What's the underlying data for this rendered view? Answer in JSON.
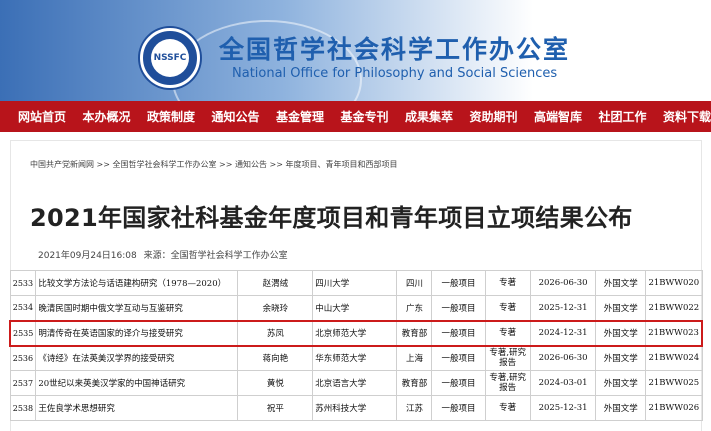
{
  "header": {
    "logo_text": "NSSFC",
    "title_cn": "全国哲学社会科学工作办公室",
    "title_en": "National Office for Philosophy and Social Sciences"
  },
  "nav": [
    "网站首页",
    "本办概况",
    "政策制度",
    "通知公告",
    "基金管理",
    "基金专刊",
    "成果集萃",
    "资助期刊",
    "高端智库",
    "社团工作",
    "资料下载"
  ],
  "breadcrumb": "中国共产党新闻网 >> 全国哲学社会科学工作办公室 >> 通知公告 >> 年度项目、青年项目和西部项目",
  "article": {
    "title": "2021年国家社科基金年度项目和青年项目立项结果公布",
    "datetime": "2021年09月24日16:08",
    "source": "来源：全国哲学社会科学工作办公室"
  },
  "table": {
    "highlight_row": 2,
    "rows": [
      [
        "2533",
        "比较文学方法论与话语建构研究（1978—2020）",
        "赵渭绒",
        "四川大学",
        "四川",
        "一般项目",
        "专著",
        "2026-06-30",
        "外国文学",
        "21BWW020"
      ],
      [
        "2534",
        "晚清民国时期中俄文学互动与互鉴研究",
        "余晓玲",
        "中山大学",
        "广东",
        "一般项目",
        "专著",
        "2025-12-31",
        "外国文学",
        "21BWW022"
      ],
      [
        "2535",
        "明清传奇在英语国家的译介与接受研究",
        "苏凤",
        "北京师范大学",
        "教育部",
        "一般项目",
        "专著",
        "2024-12-31",
        "外国文学",
        "21BWW023"
      ],
      [
        "2536",
        "《诗经》在法英美汉学界的接受研究",
        "蒋向艳",
        "华东师范大学",
        "上海",
        "一般项目",
        "专著,研究报告",
        "2026-06-30",
        "外国文学",
        "21BWW024"
      ],
      [
        "2537",
        "20世纪以来英美汉学家的中国神话研究",
        "黄悦",
        "北京语言大学",
        "教育部",
        "一般项目",
        "专著,研究报告",
        "2024-03-01",
        "外国文学",
        "21BWW025"
      ],
      [
        "2538",
        "王佐良学术思想研究",
        "祝平",
        "苏州科技大学",
        "江苏",
        "一般项目",
        "专著",
        "2025-12-31",
        "外国文学",
        "21BWW026"
      ]
    ]
  }
}
